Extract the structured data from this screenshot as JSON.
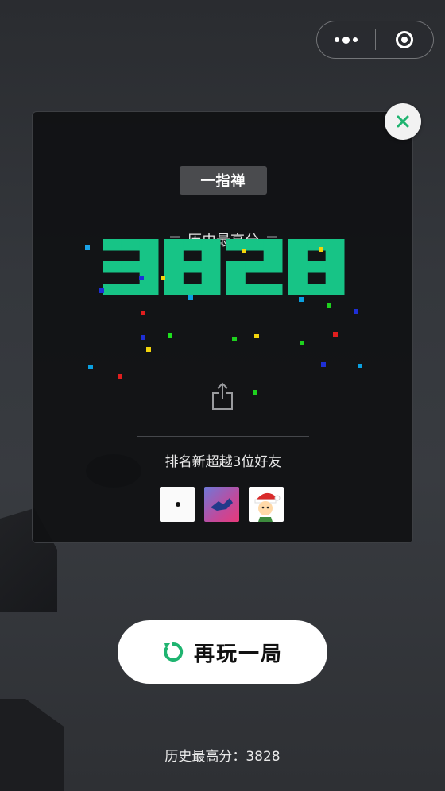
{
  "menu": {
    "more_icon": "more-dots-icon",
    "close_icon": "target-ring-icon"
  },
  "card": {
    "title": "一指禅",
    "best_label": "历史最高分",
    "best_score": "3828",
    "score_color": "#17c486",
    "rank_text": "排名新超越3位好友",
    "share_icon": "share-icon",
    "close_icon": "close-x-icon",
    "friends": [
      {
        "avatar": "white-dot-avatar"
      },
      {
        "avatar": "blue-pink-avatar"
      },
      {
        "avatar": "cartoon-santa-avatar"
      }
    ]
  },
  "replay": {
    "label": "再玩一局",
    "icon": "refresh-icon",
    "accent": "#1fb470"
  },
  "footer": {
    "best_text": "历史最高分：3828"
  }
}
